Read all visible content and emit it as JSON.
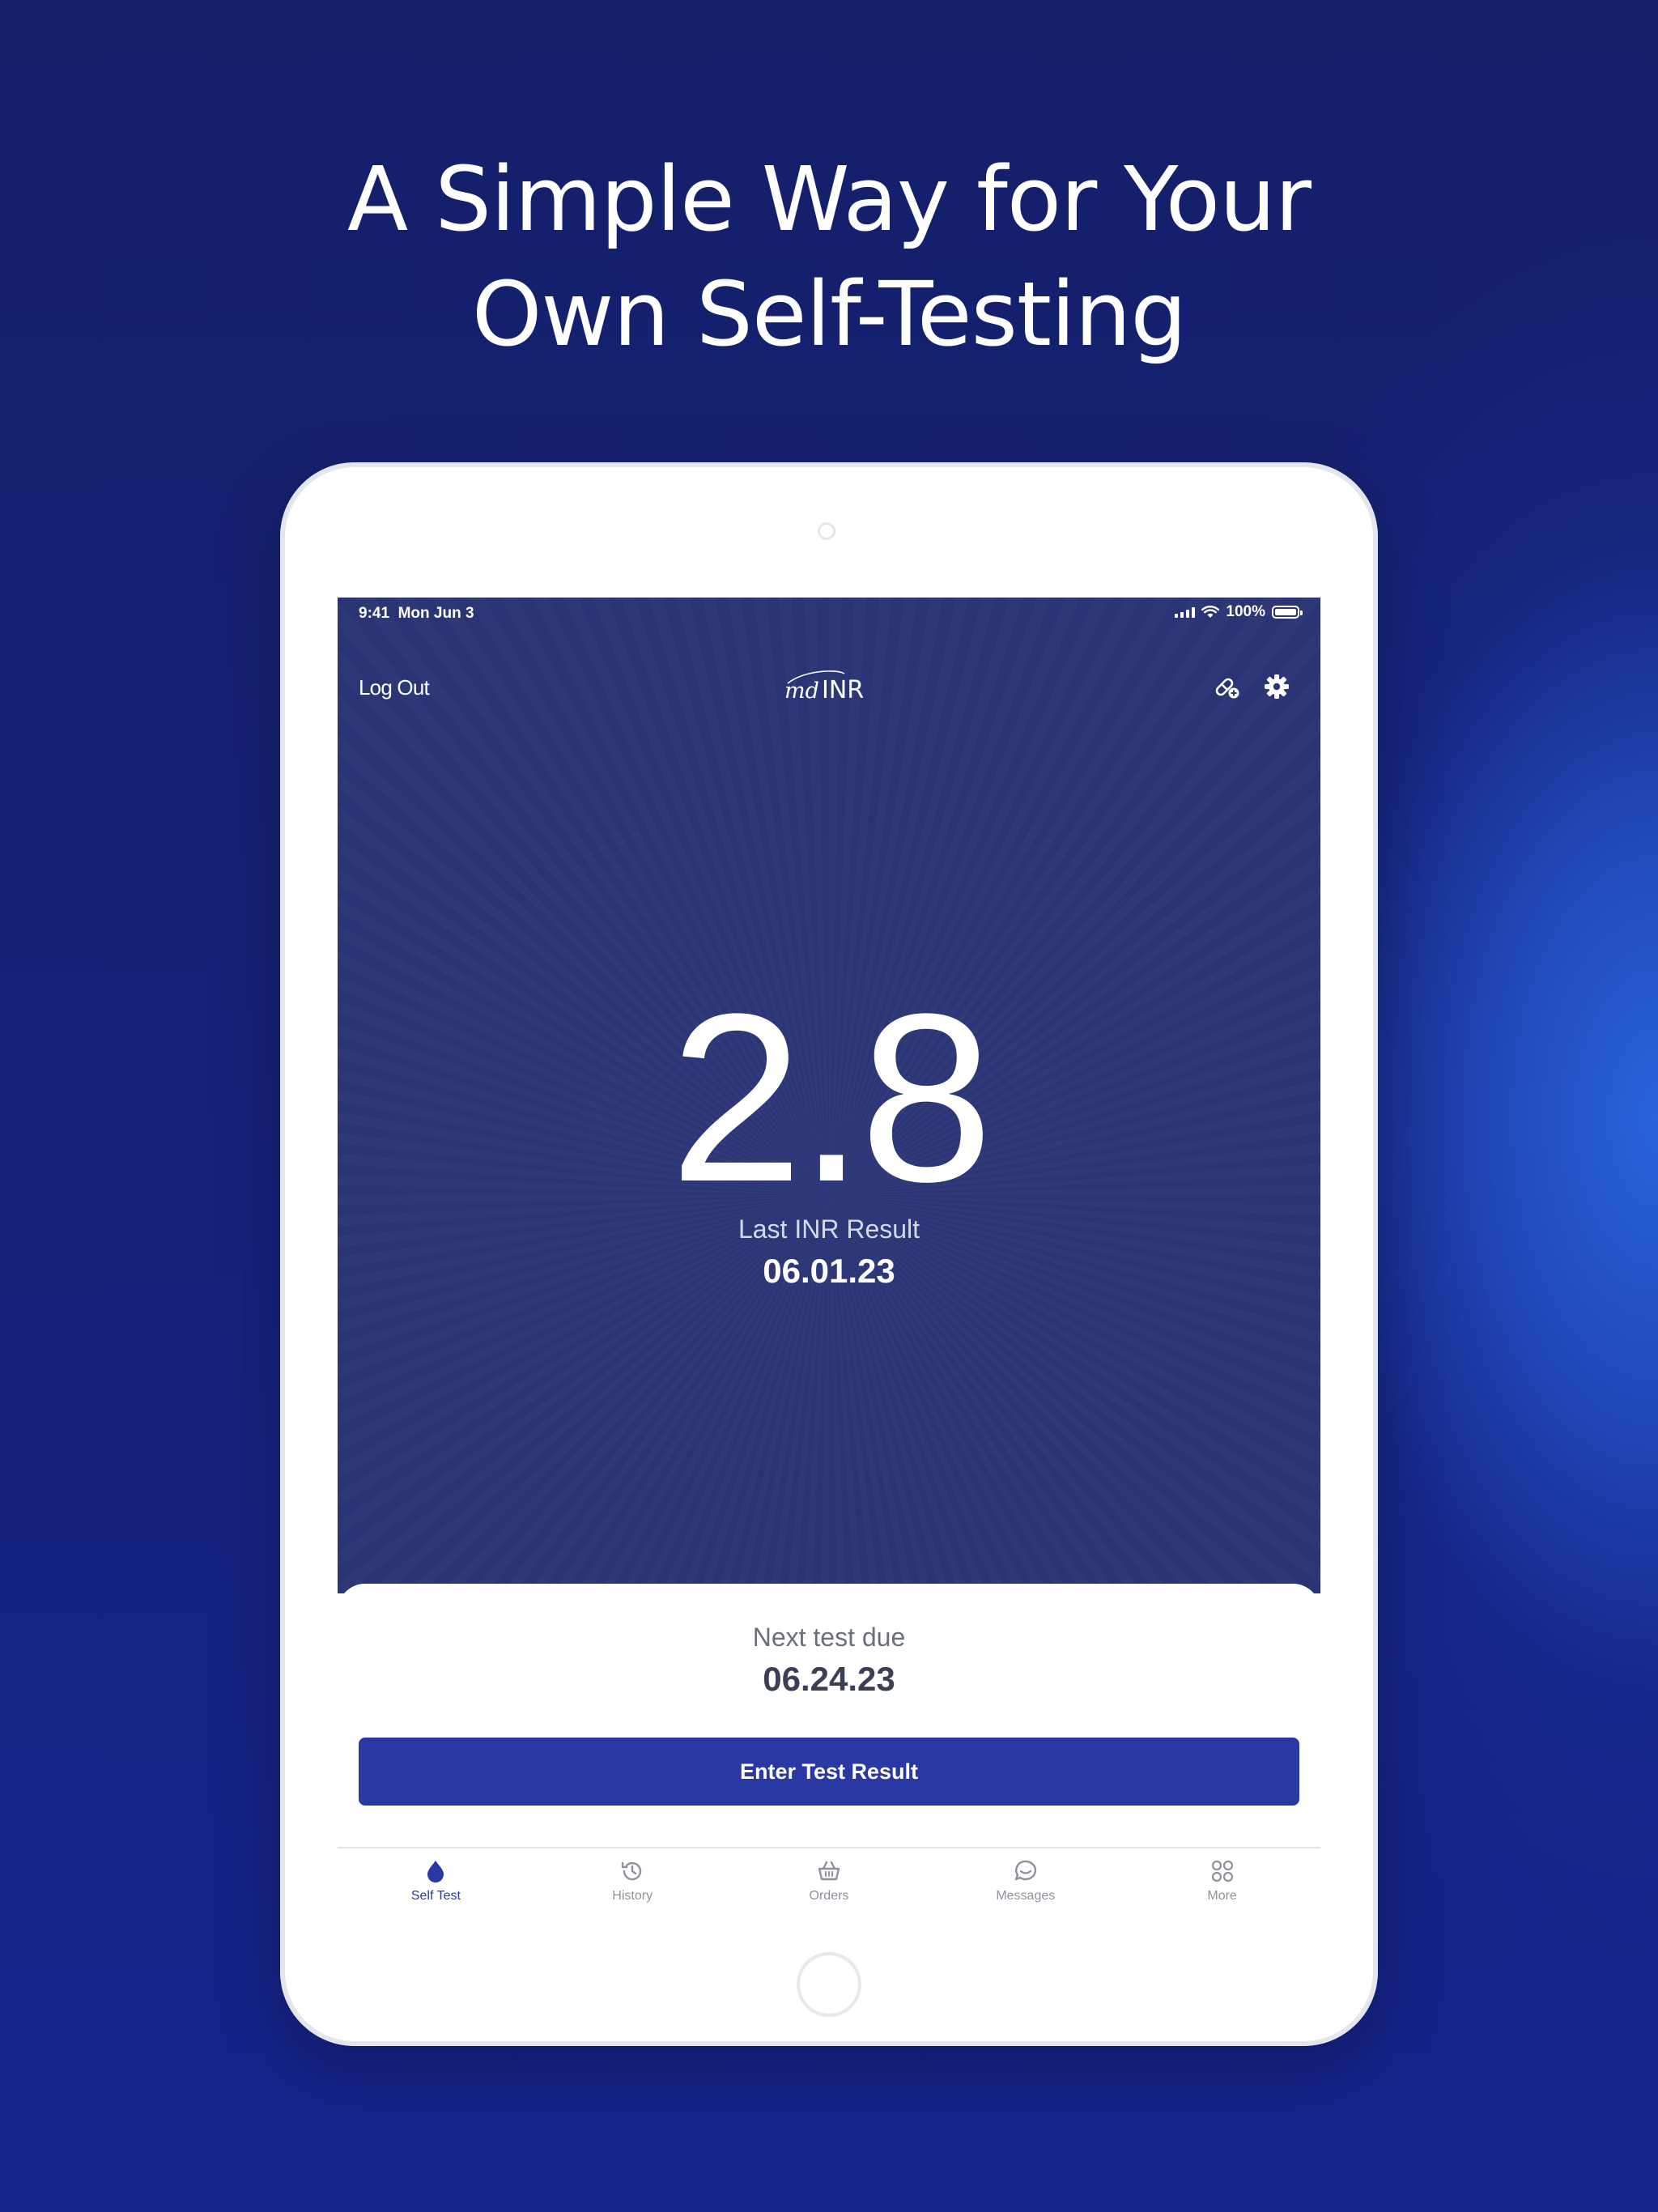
{
  "headline": {
    "line1": "A Simple Way for Your",
    "line2": "Own Self-Testing"
  },
  "status_bar": {
    "time": "9:41",
    "date": "Mon Jun 3",
    "battery": "100%"
  },
  "nav": {
    "logout_label": "Log Out",
    "logo_text_md": "md",
    "logo_text_inr": "INR"
  },
  "result": {
    "value": "2.8",
    "label": "Last INR Result",
    "date": "06.01.23"
  },
  "next_test": {
    "label": "Next test due",
    "date": "06.24.23"
  },
  "enter_button_label": "Enter Test Result",
  "tabs": [
    {
      "label": "Self Test",
      "icon": "drop-icon",
      "active": true
    },
    {
      "label": "History",
      "icon": "history-icon",
      "active": false
    },
    {
      "label": "Orders",
      "icon": "basket-icon",
      "active": false
    },
    {
      "label": "Messages",
      "icon": "chat-icon",
      "active": false
    },
    {
      "label": "More",
      "icon": "grid-icon",
      "active": false
    }
  ],
  "colors": {
    "background": "#15226f",
    "hero": "#2b3475",
    "accent": "#2a38a3",
    "inactive_tab": "#8e929c"
  }
}
